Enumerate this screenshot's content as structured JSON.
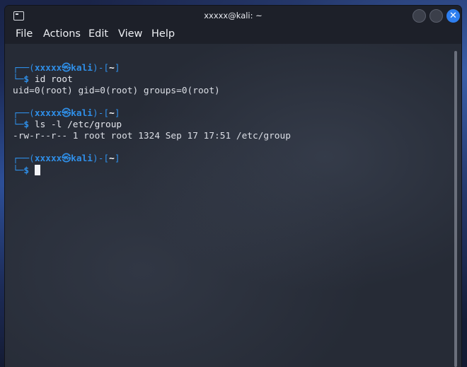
{
  "window": {
    "title": "xxxxx@kali: ~",
    "app_icon": "terminal-icon"
  },
  "controls": {
    "minimize_icon": "minimize-icon",
    "maximize_icon": "maximize-icon",
    "close_icon": "close-icon",
    "close_glyph": "✕",
    "close_color": "#2e7ff0"
  },
  "menu": {
    "items": [
      "File",
      "Actions",
      "Edit",
      "View",
      "Help"
    ]
  },
  "prompt": {
    "top_left": "┌──(",
    "user": "xxxxx",
    "at_symbol": "㉿",
    "host": "kali",
    "middle": ")-[",
    "path": "~",
    "close": "]",
    "bottom_left": "└─",
    "dollar": "$",
    "color": "#2f8fe8"
  },
  "session": [
    {
      "command": "id root",
      "output": "uid=0(root) gid=0(root) groups=0(root)"
    },
    {
      "command": "ls -l /etc/group",
      "output": "-rw-r--r-- 1 root root 1324 Sep 17 17:51 /etc/group"
    },
    {
      "command": ""
    }
  ]
}
